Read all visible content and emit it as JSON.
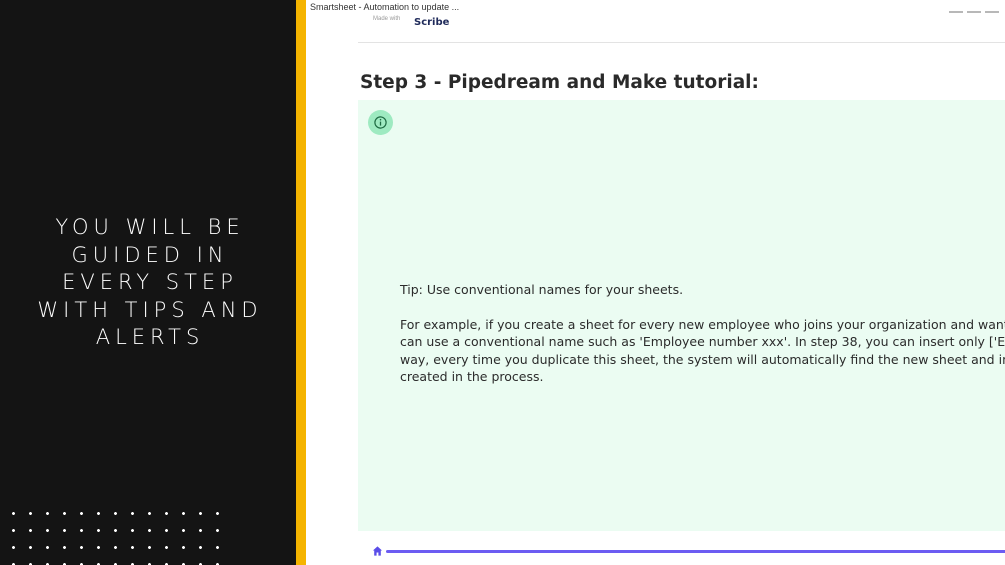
{
  "slide": {
    "headline": "YOU WILL BE\nGUIDED IN\nEVERY STEP\nWITH TIPS AND\nALERTS",
    "accent_color": "#f5b400",
    "background_color": "#141414"
  },
  "window": {
    "title": "Smartsheet - Automation to update ..."
  },
  "scribe": {
    "made_with": "Made with",
    "logo": "Scribe"
  },
  "step": {
    "heading": "Step 3 - Pipedream and Make tutorial:"
  },
  "tip": {
    "icon": "info-icon",
    "title": "Tip: Use conventional names for your sheets.",
    "body_lines": [
      "For example, if you create a sheet for every new employee who joins your organization and want to duplic",
      "can use a conventional name such as 'Employee number xxx'. In step 38, you can insert only ['Employee n",
      "way, every time you duplicate this sheet, the system will automatically find the new sheet and insert the",
      "created in the process."
    ],
    "background_color": "#ebfcf2"
  },
  "progress": {
    "icon": "home-icon",
    "fraction": 1.0,
    "color": "#6c5cf2"
  }
}
